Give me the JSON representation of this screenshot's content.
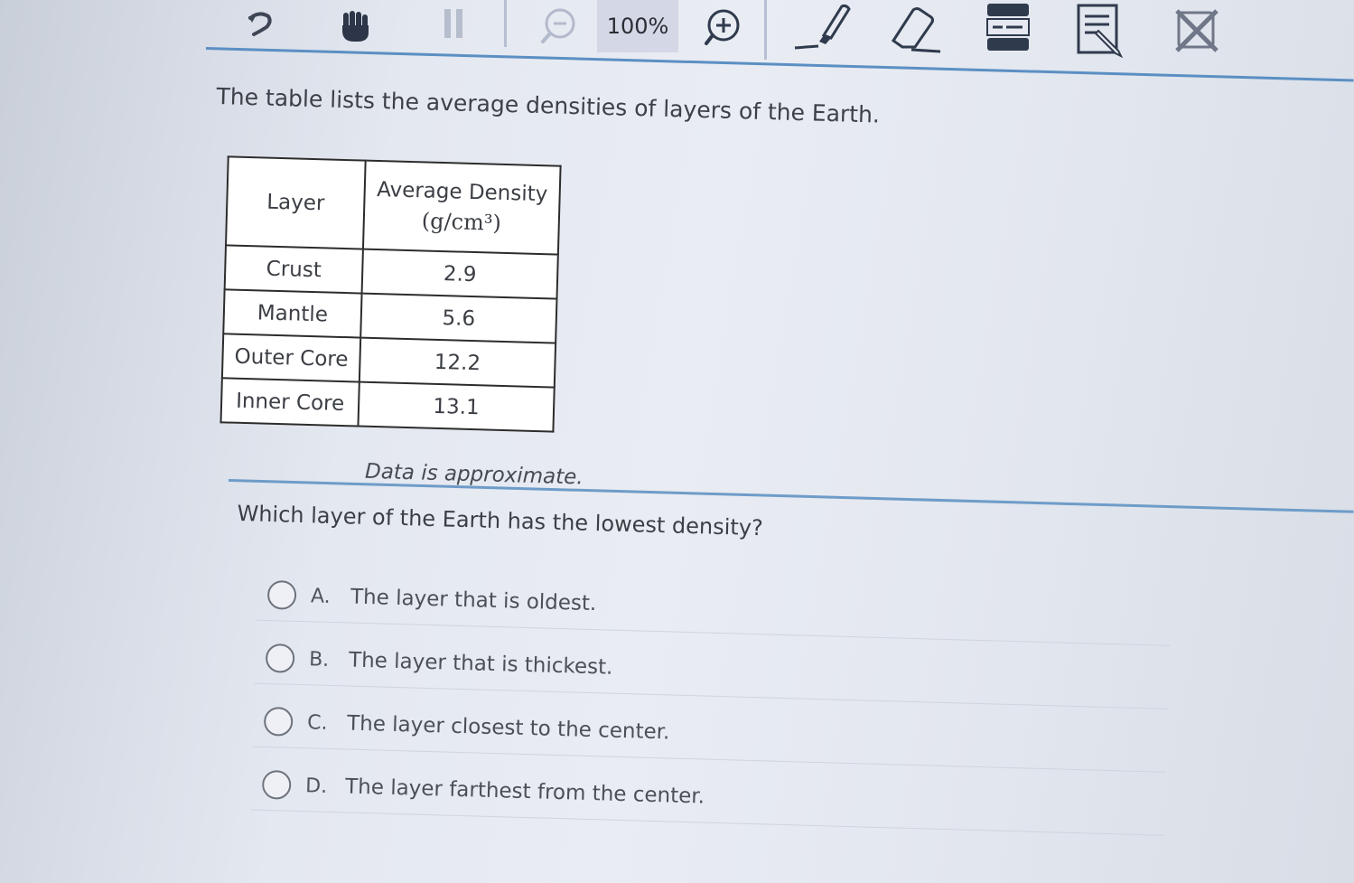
{
  "toolbar": {
    "tools": [
      {
        "name": "pointer-tool",
        "icon": "pointer-icon"
      },
      {
        "name": "pan-tool",
        "icon": "hand-icon"
      },
      {
        "name": "pause-tool",
        "icon": "pause-icon"
      },
      {
        "name": "zoom-out-tool",
        "icon": "zoom-out-icon"
      },
      {
        "name": "zoom-in-tool",
        "icon": "zoom-in-icon"
      },
      {
        "name": "highlighter-tool",
        "icon": "highlighter-icon"
      },
      {
        "name": "eraser-tool",
        "icon": "eraser-icon"
      },
      {
        "name": "line-reader-tool",
        "icon": "line-reader-icon"
      },
      {
        "name": "notepad-tool",
        "icon": "notepad-icon"
      },
      {
        "name": "answer-eliminator-tool",
        "icon": "answer-eliminator-icon"
      }
    ],
    "zoom_level": "100%",
    "accent_color": "#5b8fc3"
  },
  "stimulus": {
    "intro": "The table lists the average densities of layers of the Earth.",
    "table": {
      "headers": {
        "layer": "Layer",
        "density": "Average Density",
        "units": "(g/cm³)"
      },
      "rows": [
        {
          "layer": "Crust",
          "density": "2.9"
        },
        {
          "layer": "Mantle",
          "density": "5.6"
        },
        {
          "layer": "Outer Core",
          "density": "12.2"
        },
        {
          "layer": "Inner Core",
          "density": "13.1"
        }
      ]
    },
    "caption": "Data is approximate."
  },
  "question": {
    "text": "Which layer of the Earth has the lowest density?",
    "options": [
      {
        "letter": "A.",
        "text": "The layer that is oldest."
      },
      {
        "letter": "B.",
        "text": "The layer that is thickest."
      },
      {
        "letter": "C.",
        "text": "The layer closest to the center."
      },
      {
        "letter": "D.",
        "text": "The layer farthest from the center."
      }
    ]
  }
}
